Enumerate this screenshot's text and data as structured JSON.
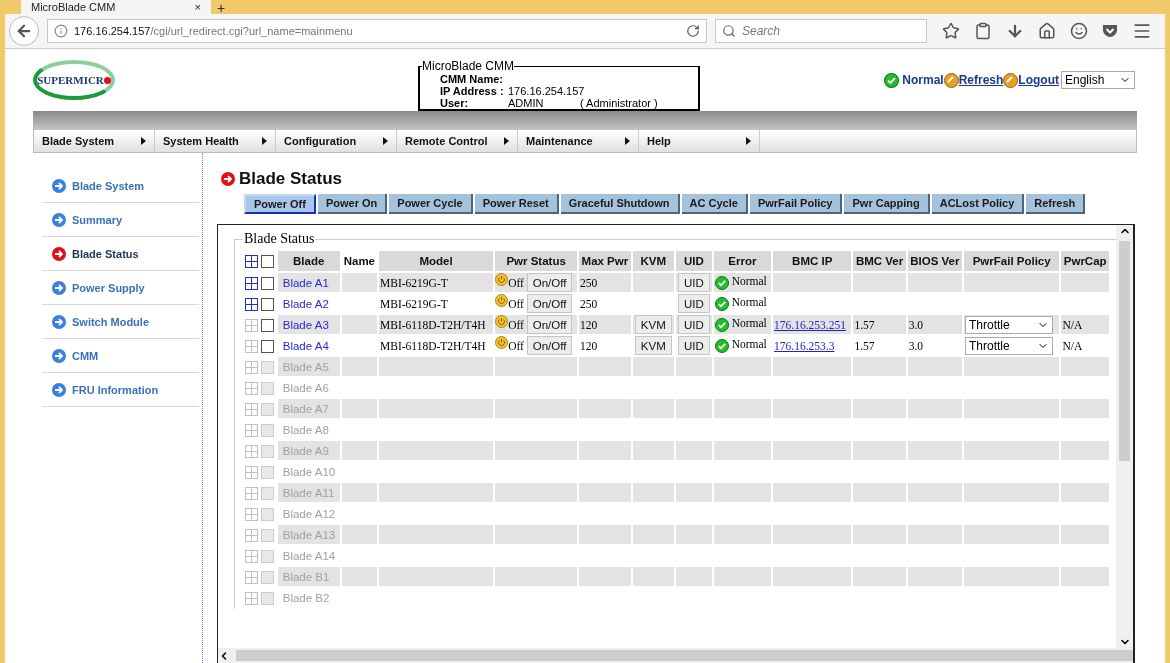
{
  "browser": {
    "tab_title": "MicroBlade CMM",
    "tab_close": "×",
    "new_tab": "+",
    "url_host": "176.16.254.157",
    "url_path": "/cgi/url_redirect.cgi?url_name=mainmenu",
    "search_placeholder": "Search"
  },
  "header": {
    "logo": "SUPERMICR",
    "cmm_box": {
      "legend": "MicroBlade CMM",
      "name_label": "CMM Name:",
      "ip_label": "IP Address :",
      "ip_value": "176.16.254.157",
      "user_label": "User:",
      "user_value": "ADMIN",
      "user_role": "( Administrator )"
    },
    "status": "Normal",
    "links": [
      "Refresh",
      "Logout"
    ],
    "language": "English"
  },
  "menu": [
    {
      "label": "Blade System"
    },
    {
      "label": "System Health"
    },
    {
      "label": "Configuration"
    },
    {
      "label": "Remote Control"
    },
    {
      "label": "Maintenance"
    },
    {
      "label": "Help"
    }
  ],
  "sidebar": {
    "items": [
      {
        "label": "Blade System",
        "selected": false
      },
      {
        "label": "Summary",
        "selected": false
      },
      {
        "label": "Blade Status",
        "selected": true
      },
      {
        "label": "Power Supply",
        "selected": false
      },
      {
        "label": "Switch Module",
        "selected": false
      },
      {
        "label": "CMM",
        "selected": false
      },
      {
        "label": "FRU Information",
        "selected": false
      }
    ]
  },
  "page_title": "Blade Status",
  "actions": [
    {
      "label": "Power Off",
      "selected": true
    },
    {
      "label": "Power On",
      "selected": false
    },
    {
      "label": "Power Cycle",
      "selected": false
    },
    {
      "label": "Power Reset",
      "selected": false
    },
    {
      "label": "Graceful Shutdown",
      "selected": false
    },
    {
      "label": "AC Cycle",
      "selected": false
    },
    {
      "label": "PwrFail Policy",
      "selected": false
    },
    {
      "label": "Pwr Capping",
      "selected": false
    },
    {
      "label": "ACLost Policy",
      "selected": false
    },
    {
      "label": "Refresh",
      "selected": false
    }
  ],
  "table": {
    "legend": "Blade Status",
    "header_checked": false,
    "columns": [
      "Blade",
      "Name",
      "Model",
      "Pwr Status",
      "Max Pwr",
      "KVM",
      "UID",
      "Error",
      "BMC IP",
      "BMC Ver",
      "BIOS Ver",
      "PwrFail Policy",
      "PwrCap"
    ],
    "rows": [
      {
        "blade": "Blade A1",
        "disabled": false,
        "expandable": true,
        "checked": false,
        "model": "MBI-6219G-T",
        "pwr_status": "Off",
        "power_button": "On/Off",
        "max_pwr": "250",
        "uid_button": "UID",
        "error": "Normal"
      },
      {
        "blade": "Blade A2",
        "disabled": false,
        "expandable": true,
        "checked": false,
        "model": "MBI-6219G-T",
        "pwr_status": "Off",
        "power_button": "On/Off",
        "max_pwr": "250",
        "uid_button": "UID",
        "error": "Normal"
      },
      {
        "blade": "Blade A3",
        "disabled": false,
        "expandable": false,
        "checked": false,
        "model": "MBI-6118D-T2H/T4H",
        "pwr_status": "Off",
        "power_button": "On/Off",
        "max_pwr": "120",
        "kvm_button": "KVM",
        "uid_button": "UID",
        "error": "Normal",
        "bmc_ip": "176.16.253.251",
        "bmc_ver": "1.57",
        "bios_ver": "3.0",
        "pwrfail_policy": "Throttle",
        "pwrcap": "N/A"
      },
      {
        "blade": "Blade A4",
        "disabled": false,
        "expandable": false,
        "checked": false,
        "model": "MBI-6118D-T2H/T4H",
        "pwr_status": "Off",
        "power_button": "On/Off",
        "max_pwr": "120",
        "kvm_button": "KVM",
        "uid_button": "UID",
        "error": "Normal",
        "bmc_ip": "176.16.253.3",
        "bmc_ver": "1.57",
        "bios_ver": "3.0",
        "pwrfail_policy": "Throttle",
        "pwrcap": "N/A"
      },
      {
        "blade": "Blade A5",
        "disabled": true,
        "expandable": false,
        "checked": false
      },
      {
        "blade": "Blade A6",
        "disabled": true,
        "expandable": false,
        "checked": false
      },
      {
        "blade": "Blade A7",
        "disabled": true,
        "expandable": false,
        "checked": false
      },
      {
        "blade": "Blade A8",
        "disabled": true,
        "expandable": false,
        "checked": false
      },
      {
        "blade": "Blade A9",
        "disabled": true,
        "expandable": false,
        "checked": false
      },
      {
        "blade": "Blade A10",
        "disabled": true,
        "expandable": false,
        "checked": false
      },
      {
        "blade": "Blade A11",
        "disabled": true,
        "expandable": false,
        "checked": false
      },
      {
        "blade": "Blade A12",
        "disabled": true,
        "expandable": false,
        "checked": false
      },
      {
        "blade": "Blade A13",
        "disabled": true,
        "expandable": false,
        "checked": false
      },
      {
        "blade": "Blade A14",
        "disabled": true,
        "expandable": false,
        "checked": false
      },
      {
        "blade": "Blade B1",
        "disabled": true,
        "expandable": false,
        "checked": false
      },
      {
        "blade": "Blade B2",
        "disabled": true,
        "expandable": false,
        "checked": false
      }
    ]
  }
}
